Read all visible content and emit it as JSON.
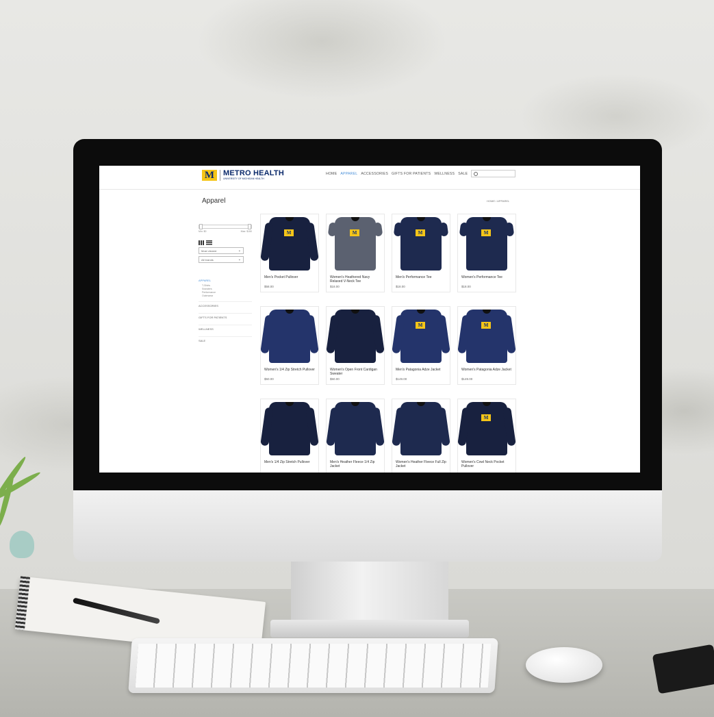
{
  "site": {
    "logo_letter": "M",
    "logo_name": "METRO HEALTH",
    "logo_sub": "UNIVERSITY OF MICHIGAN HEALTH"
  },
  "nav": {
    "items": [
      {
        "label": "HOME",
        "active": false
      },
      {
        "label": "APPAREL",
        "active": true
      },
      {
        "label": "ACCESSORIES",
        "active": false
      },
      {
        "label": "GIFTS FOR PATIENTS",
        "active": false
      },
      {
        "label": "WELLNESS",
        "active": false
      },
      {
        "label": "SALE",
        "active": false
      }
    ],
    "search_icon": "search-icon"
  },
  "page": {
    "title": "Apparel",
    "breadcrumb": "HOME / APPAREL"
  },
  "filters": {
    "price_min": "Min: $0",
    "price_max": "Max: $150",
    "sort_selected": "Most viewed",
    "brand_selected": "All brands"
  },
  "categories": {
    "active": "APPAREL",
    "subcategories": [
      "T-Shirts",
      "Sweaters",
      "Performance",
      "Outerwear"
    ],
    "others": [
      "ACCESSORIES",
      "GIFTS FOR PATIENTS",
      "WELLNESS",
      "SALE"
    ]
  },
  "products": [
    {
      "name": "Men's Pocket Pullover",
      "price": "$58.00",
      "style": "navy2",
      "badge": "M"
    },
    {
      "name": "Women's Heathered Navy Relaxed V-Neck Tee",
      "price": "$18.00",
      "style": "grey",
      "badge": "M"
    },
    {
      "name": "Men's Performance Tee",
      "price": "$18.00",
      "style": "navy",
      "badge": "M"
    },
    {
      "name": "Women's Performance Tee",
      "price": "$18.00",
      "style": "navy",
      "badge": "M"
    },
    {
      "name": "Women's 1/4 Zip Stretch Pullover",
      "price": "$50.00",
      "style": "blue",
      "badge": ""
    },
    {
      "name": "Women's Open Front Cardigan Sweater",
      "price": "$50.00",
      "style": "navy2",
      "badge": ""
    },
    {
      "name": "Men's Patagonia Adze Jacket",
      "price": "$149.00",
      "style": "blue",
      "badge": "M"
    },
    {
      "name": "Women's Patagonia Adze Jacket",
      "price": "$149.00",
      "style": "blue",
      "badge": "M"
    },
    {
      "name": "Men's 1/4 Zip Stretch Pullover",
      "price": "",
      "style": "navy2",
      "badge": ""
    },
    {
      "name": "Men's Heather Fleece 1/4 Zip Jacket",
      "price": "",
      "style": "navy",
      "badge": ""
    },
    {
      "name": "Women's Heather Fleece Full Zip Jacket",
      "price": "",
      "style": "navy",
      "badge": ""
    },
    {
      "name": "Women's Cowl Neck Pocket Pullover",
      "price": "",
      "style": "navy2",
      "badge": "M"
    }
  ]
}
